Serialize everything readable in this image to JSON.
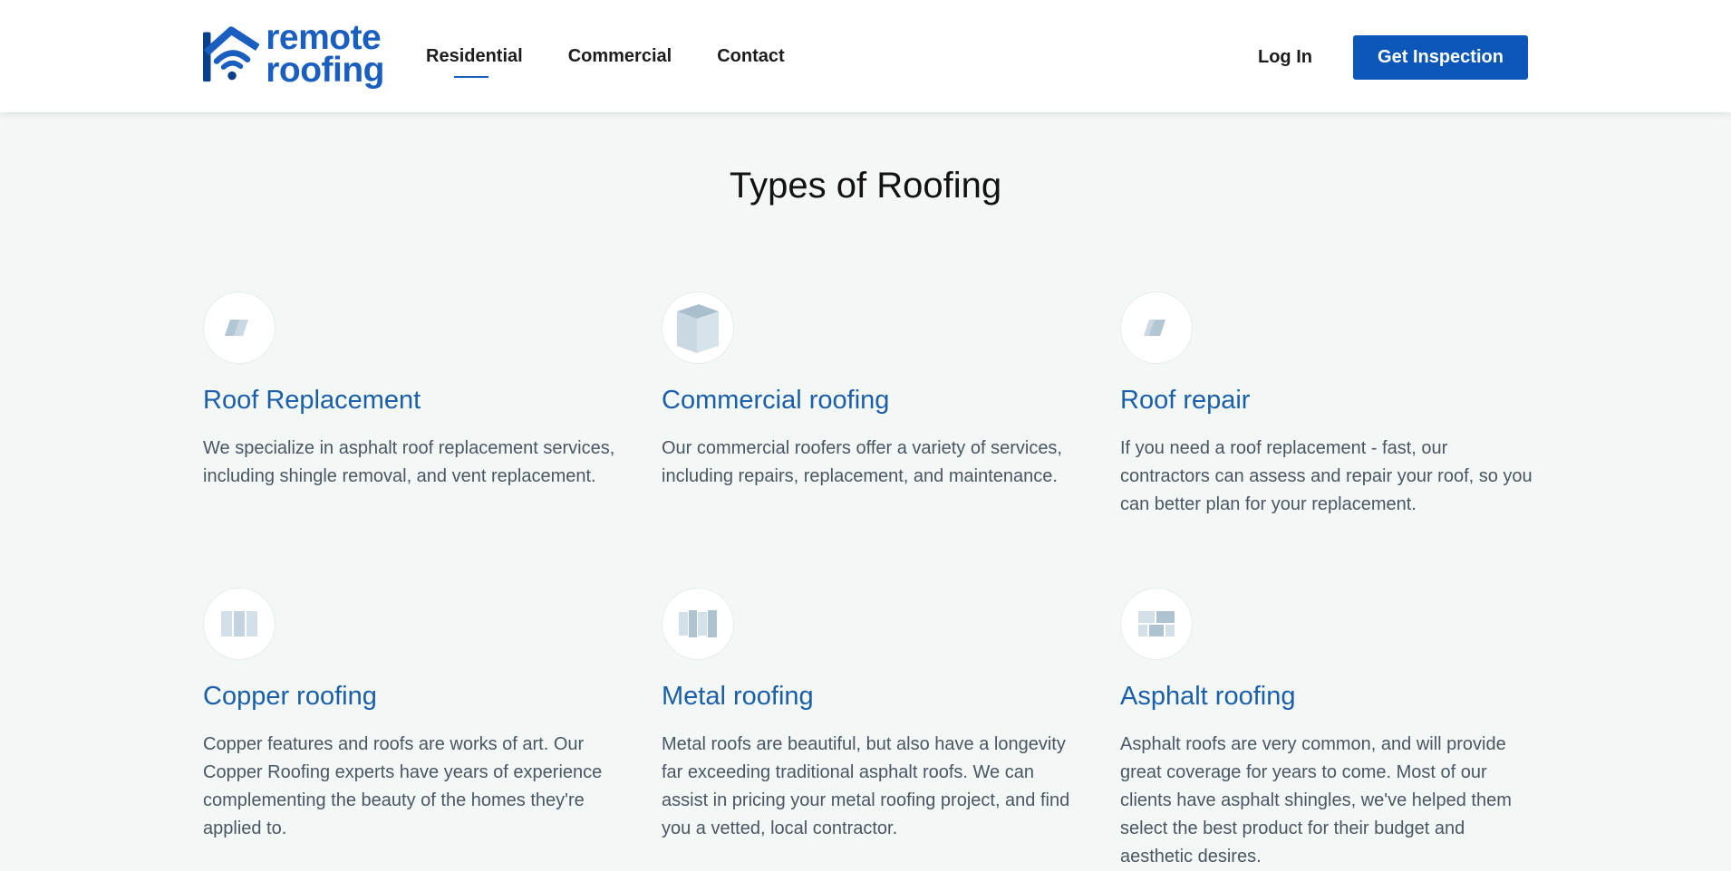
{
  "header": {
    "logo": {
      "line1": "remote",
      "line2": "roofing"
    },
    "nav": [
      {
        "label": "Residential",
        "active": true
      },
      {
        "label": "Commercial",
        "active": false
      },
      {
        "label": "Contact",
        "active": false
      }
    ],
    "login_label": "Log In",
    "cta_label": "Get Inspection"
  },
  "main": {
    "title": "Types of Roofing",
    "cards": [
      {
        "icon": "roof-shingle-icon",
        "title": "Roof Replacement",
        "desc": "We specialize in asphalt roof replacement services, including shingle removal, and vent replacement."
      },
      {
        "icon": "building-cube-icon",
        "title": "Commercial roofing",
        "desc": "Our commercial roofers offer a variety of services, including repairs, replacement, and maintenance."
      },
      {
        "icon": "roof-shingle-icon",
        "title": "Roof repair",
        "desc": "If you need a roof replacement - fast, our contractors can assess and repair your roof, so you can better plan for your replacement."
      },
      {
        "icon": "copper-panel-icon",
        "title": "Copper roofing",
        "desc": "Copper features and roofs are works of art. Our Copper Roofing experts have years of experience complementing the beauty of the homes they're applied to."
      },
      {
        "icon": "metal-panel-icon",
        "title": "Metal roofing",
        "desc": "Metal roofs are beautiful, but also have a longevity far exceeding traditional asphalt roofs. We can assist in pricing your metal roofing project, and find you a vetted, local contractor."
      },
      {
        "icon": "asphalt-tile-icon",
        "title": "Asphalt roofing",
        "desc": "Asphalt roofs are very common, and will provide great coverage for years to come. Most of our clients have asphalt shingles, we've helped them select the best product for their budget and aesthetic desires."
      }
    ]
  },
  "colors": {
    "brand": "#1a5fbf",
    "cta": "#0a57b9",
    "card_title": "#1a5fa8",
    "page_bg": "#f3f7f6",
    "icon_fill": "#c9d8e2"
  }
}
